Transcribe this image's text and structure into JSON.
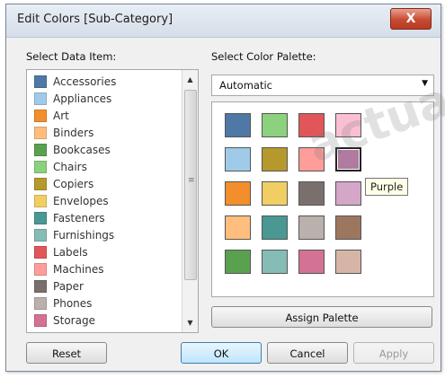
{
  "dialog": {
    "title": "Edit Colors [Sub-Category]",
    "close_label": "X"
  },
  "data_items": {
    "label": "Select Data Item:",
    "items": [
      {
        "label": "Accessories",
        "color": "#4e79a7"
      },
      {
        "label": "Appliances",
        "color": "#a0cbe8"
      },
      {
        "label": "Art",
        "color": "#f28e2b"
      },
      {
        "label": "Binders",
        "color": "#ffbe7d"
      },
      {
        "label": "Bookcases",
        "color": "#59a14f"
      },
      {
        "label": "Chairs",
        "color": "#8cd17d"
      },
      {
        "label": "Copiers",
        "color": "#b6992d"
      },
      {
        "label": "Envelopes",
        "color": "#f1ce63"
      },
      {
        "label": "Fasteners",
        "color": "#499894"
      },
      {
        "label": "Furnishings",
        "color": "#86bcb6"
      },
      {
        "label": "Labels",
        "color": "#e15759"
      },
      {
        "label": "Machines",
        "color": "#ff9d9a"
      },
      {
        "label": "Paper",
        "color": "#79706e"
      },
      {
        "label": "Phones",
        "color": "#bab0ac"
      },
      {
        "label": "Storage",
        "color": "#d37295"
      }
    ]
  },
  "palette": {
    "label": "Select Color Palette:",
    "selected": "Automatic",
    "swatches": [
      "#4e79a7",
      "#8cd17d",
      "#e15759",
      "#fabfd2",
      "#a0cbe8",
      "#b6992d",
      "#ff9d9a",
      "#b07aa1",
      "#f28e2b",
      "#f1ce63",
      "#79706e",
      "#d4a6c8",
      "#ffbe7d",
      "#499894",
      "#bab0ac",
      "#9d7660",
      "#59a14f",
      "#86bcb6",
      "#d37295",
      "#d7b5a6"
    ],
    "hovered_index": 7,
    "tooltip": "Purple",
    "assign_label": "Assign Palette"
  },
  "buttons": {
    "reset": "Reset",
    "ok": "OK",
    "cancel": "Cancel",
    "apply": "Apply"
  },
  "watermark": "actua"
}
